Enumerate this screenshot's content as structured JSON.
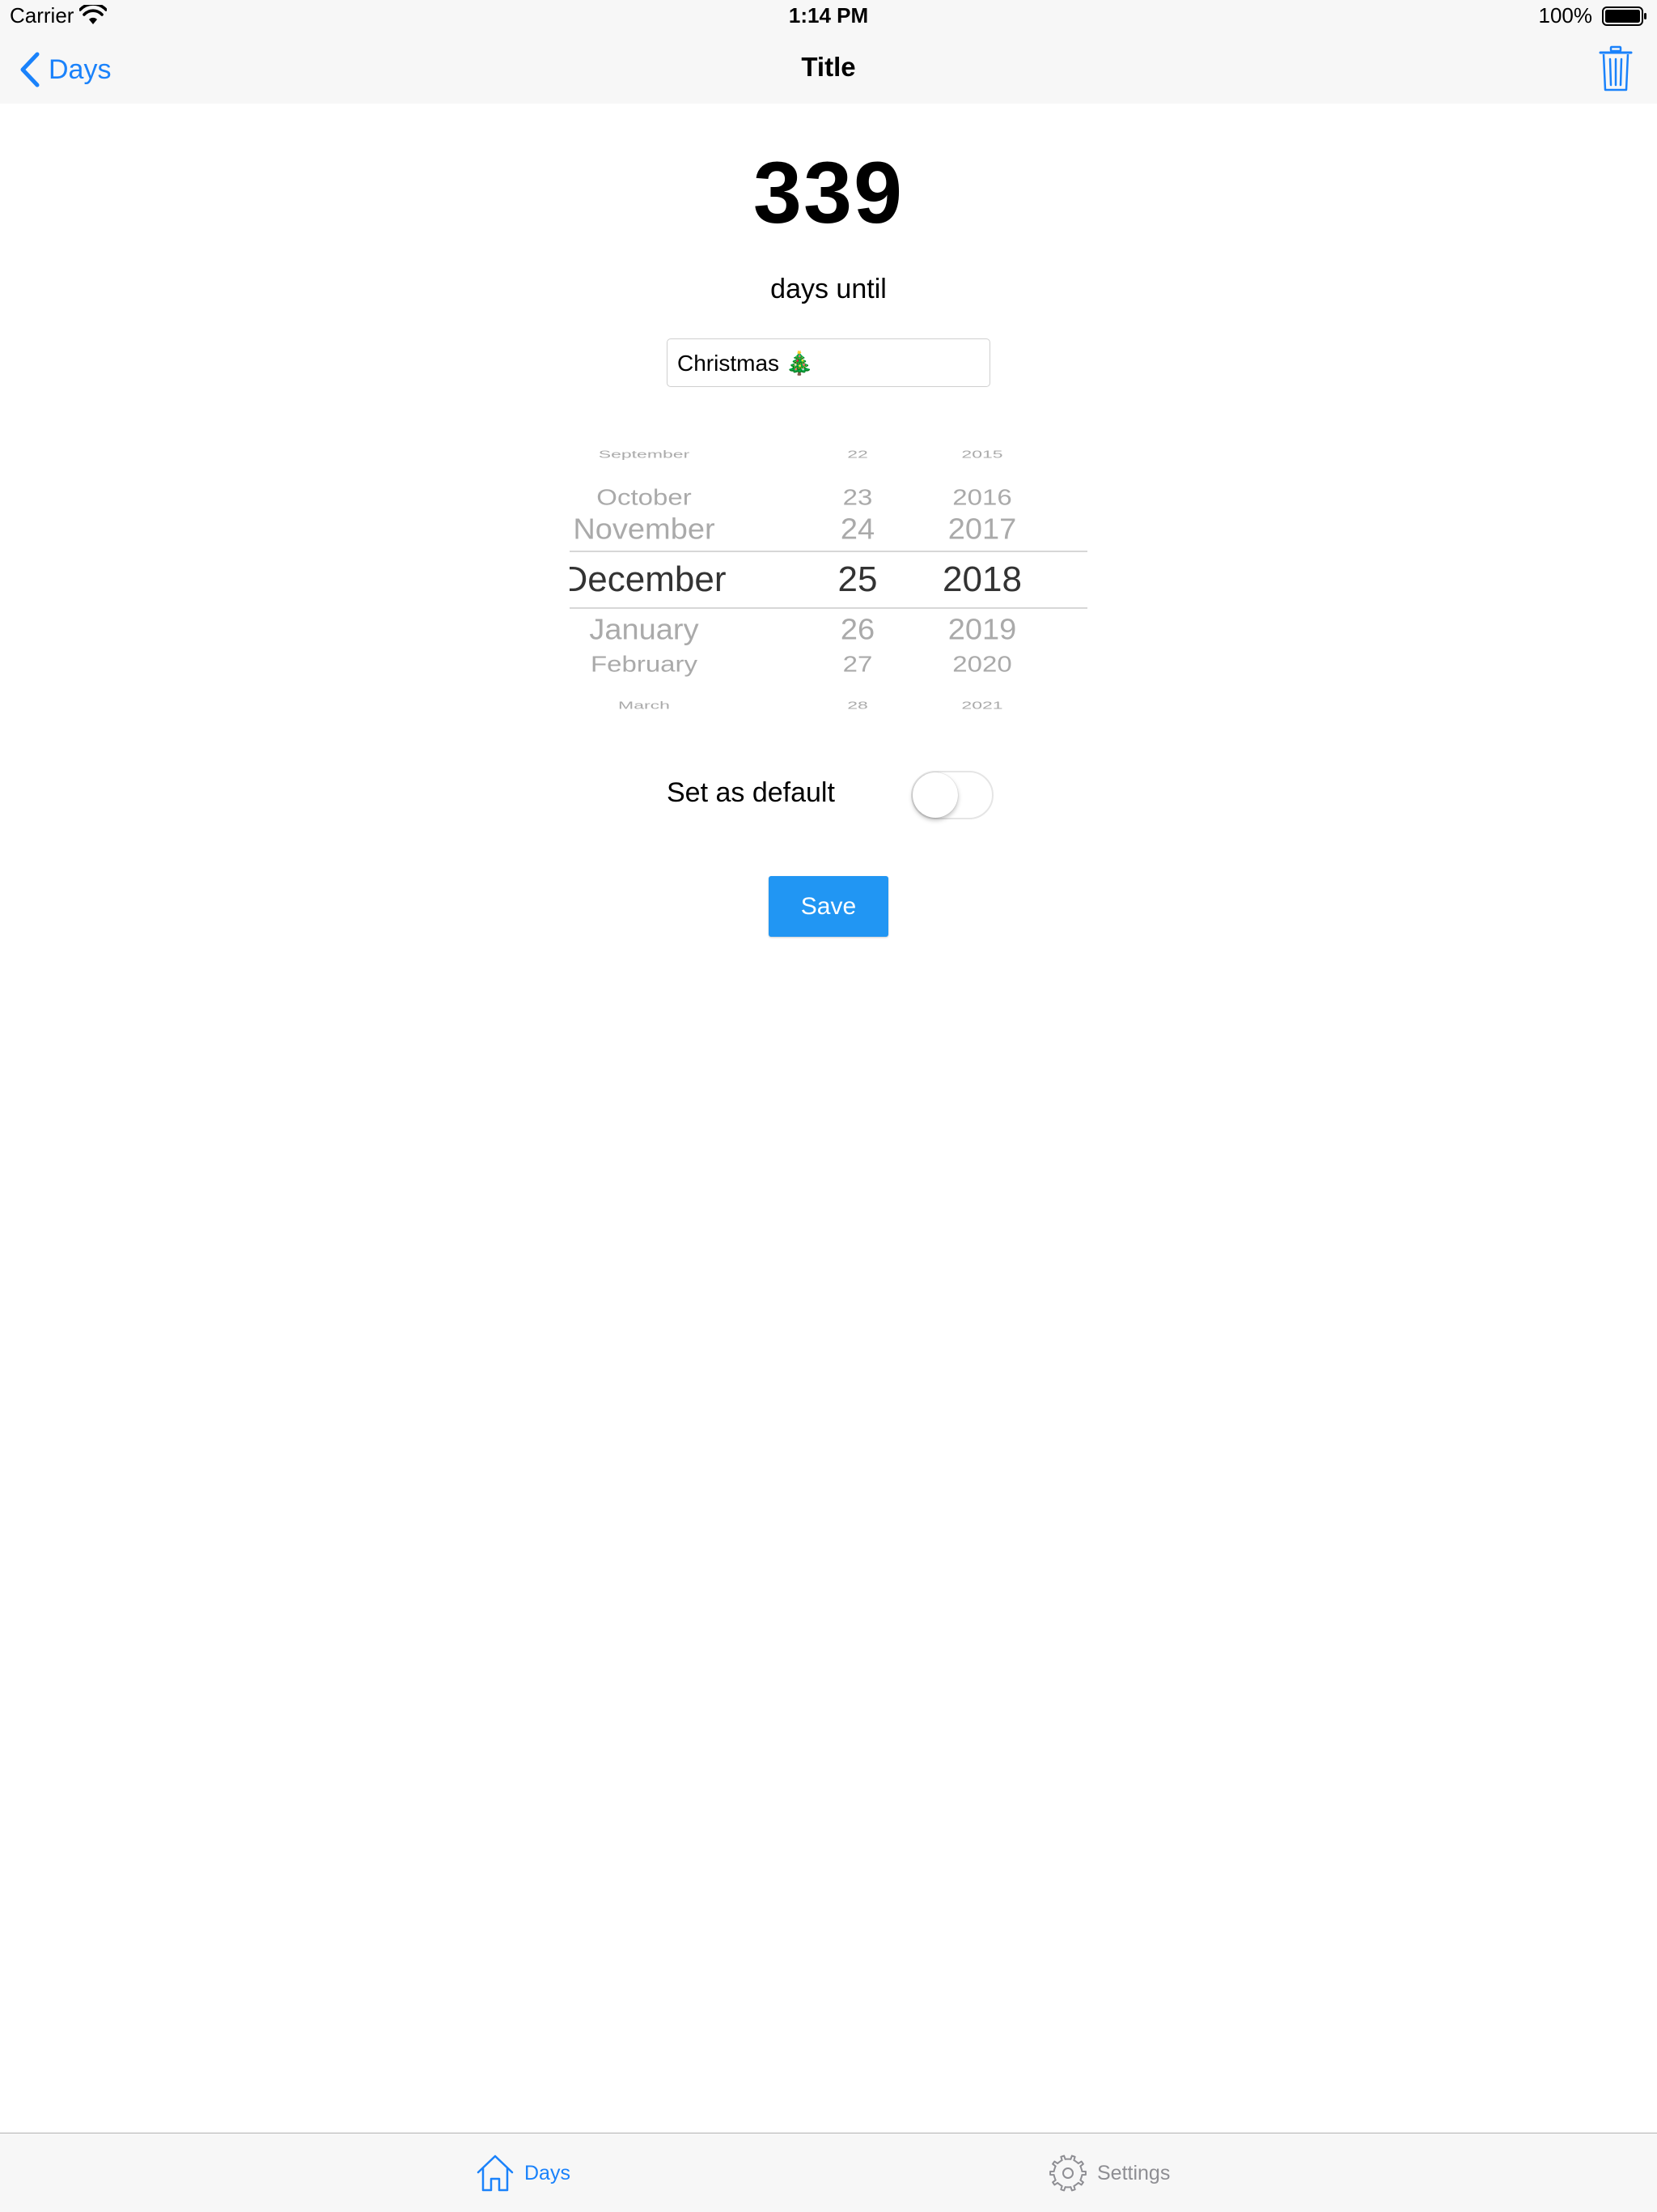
{
  "status_bar": {
    "carrier": "Carrier",
    "time": "1:14 PM",
    "battery": "100%"
  },
  "nav": {
    "back_label": "Days",
    "title": "Title",
    "trash_icon": "trash-icon"
  },
  "content": {
    "days_count": "339",
    "days_until": "days until",
    "event_name": "Christmas 🎄"
  },
  "date_picker": {
    "months": [
      "September",
      "October",
      "November",
      "December",
      "January",
      "February",
      "March"
    ],
    "days": [
      "22",
      "23",
      "24",
      "25",
      "26",
      "27",
      "28"
    ],
    "years": [
      "2015",
      "2016",
      "2017",
      "2018",
      "2019",
      "2020",
      "2021"
    ],
    "selected": {
      "month": "December",
      "day": "25",
      "year": "2018"
    }
  },
  "default_toggle": {
    "label": "Set as default",
    "on": false
  },
  "save_label": "Save",
  "tabs": [
    {
      "label": "Days",
      "icon": "home-icon",
      "active": true
    },
    {
      "label": "Settings",
      "icon": "gear-icon",
      "active": false
    }
  ],
  "colors": {
    "accent": "#1a82fb",
    "save_button": "#2196f3",
    "bar_background": "#f7f7f7"
  }
}
